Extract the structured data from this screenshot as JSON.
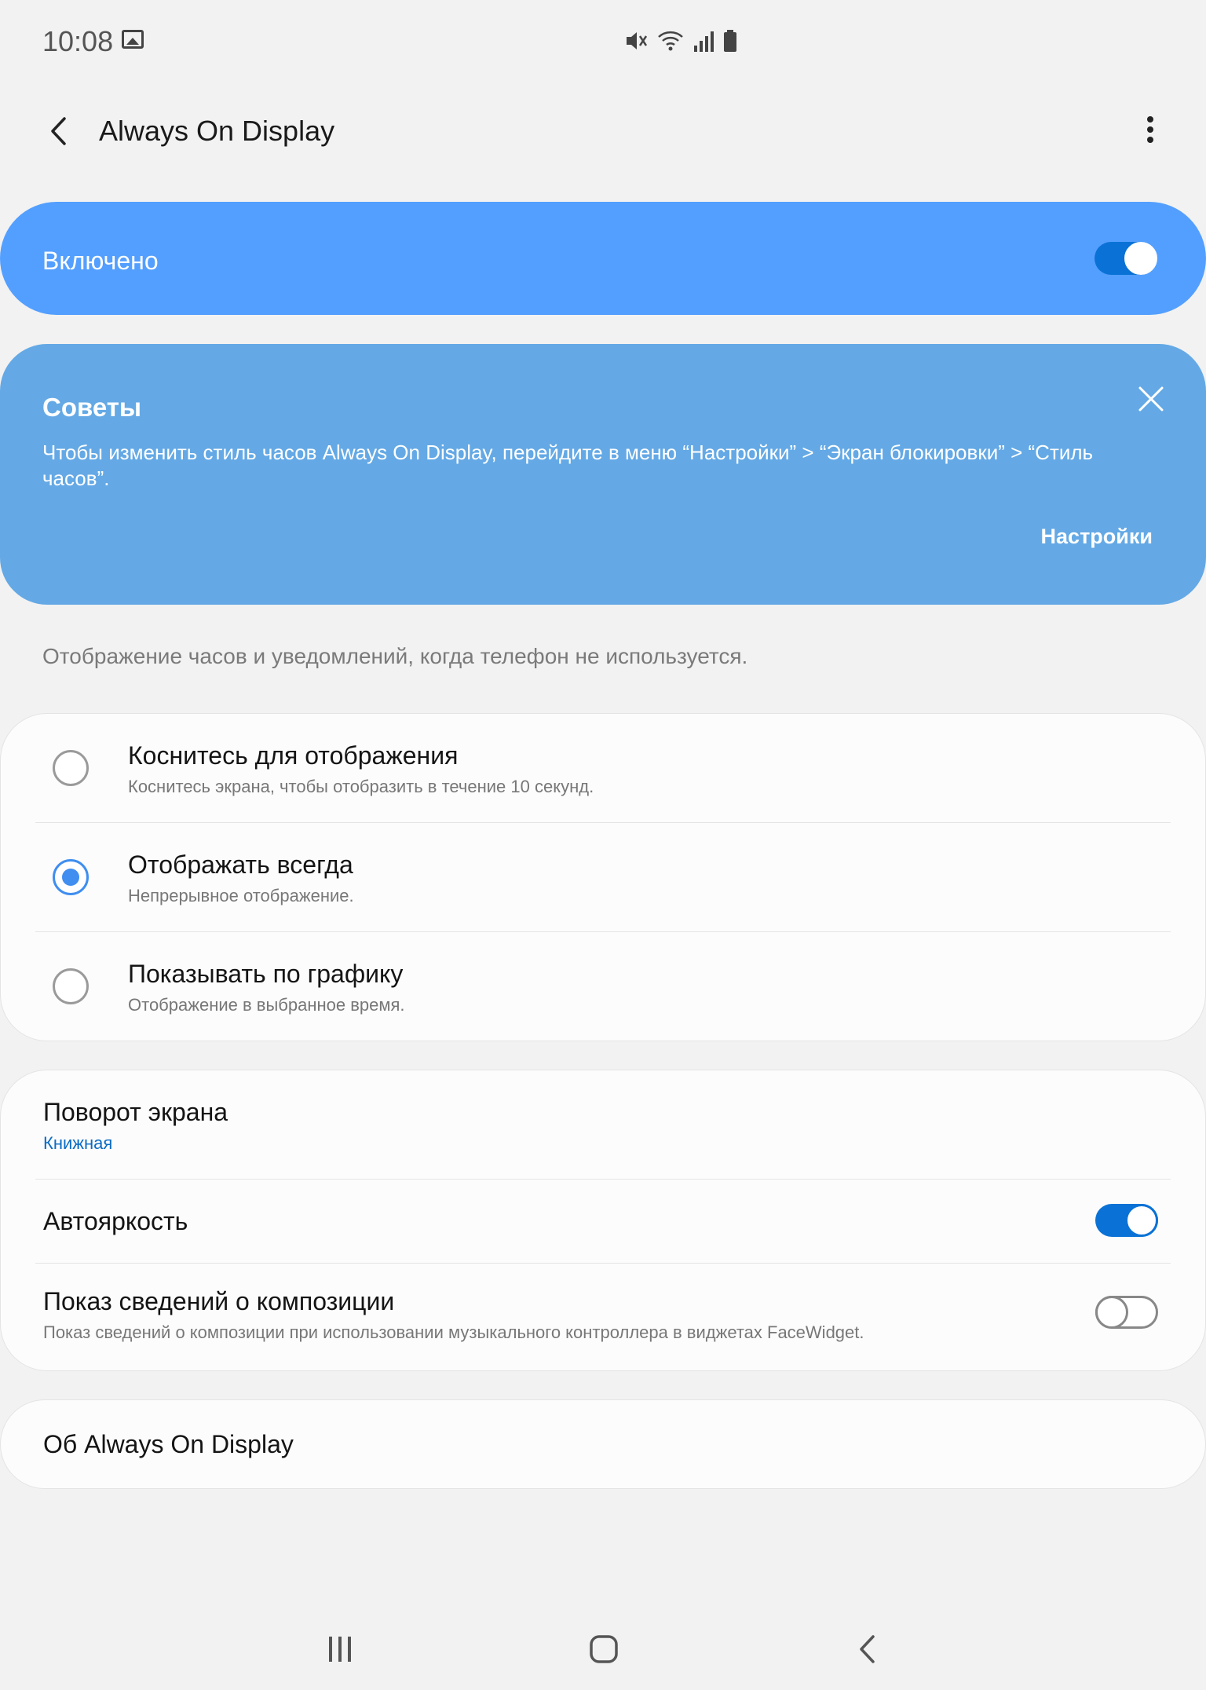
{
  "status_bar": {
    "time": "10:08",
    "icons": [
      "image-icon",
      "mute-icon",
      "wifi-icon",
      "signal-icon",
      "battery-icon"
    ]
  },
  "header": {
    "title": "Always On Display"
  },
  "master_switch": {
    "label": "Включено",
    "on": true
  },
  "tips": {
    "title": "Советы",
    "text": "Чтобы изменить стиль часов Always On Display, перейдите в меню “Настройки” > “Экран блокировки” > “Стиль часов”.",
    "link": "Настройки"
  },
  "description": "Отображение часов и уведомлений, когда телефон не используется.",
  "display_modes": [
    {
      "title": "Коснитесь для отображения",
      "subtitle": "Коснитесь экрана, чтобы отобразить в течение 10 секунд.",
      "selected": false
    },
    {
      "title": "Отображать всегда",
      "subtitle": "Непрерывное отображение.",
      "selected": true
    },
    {
      "title": "Показывать по графику",
      "subtitle": "Отображение в выбранное время.",
      "selected": false
    }
  ],
  "settings": {
    "rotation": {
      "title": "Поворот экрана",
      "value": "Книжная"
    },
    "auto_brightness": {
      "title": "Автояркость",
      "on": true
    },
    "music_info": {
      "title": "Показ сведений о композиции",
      "subtitle": "Показ сведений о композиции при использовании музыкального контроллера в виджетах FaceWidget.",
      "on": false
    }
  },
  "about": {
    "title": "Об Always On Display"
  },
  "colors": {
    "accent": "#0a72d6",
    "master_bg": "#539fff",
    "tips_bg": "#64a9e5",
    "link_blue": "#0b6cc4"
  }
}
